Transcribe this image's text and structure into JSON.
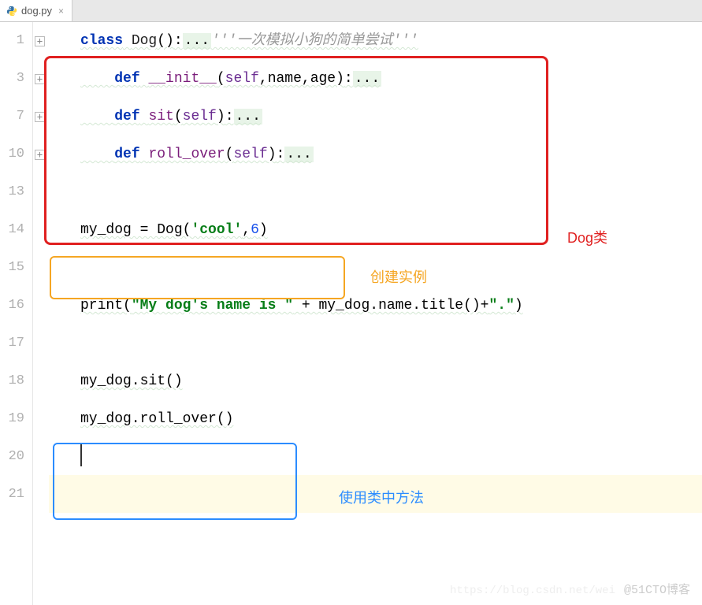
{
  "tab": {
    "filename": "dog.py",
    "close": "×"
  },
  "gutter": {
    "lines": [
      "1",
      "",
      "3",
      "",
      "7",
      "",
      "10",
      "",
      "13",
      "14",
      "",
      "15",
      "",
      "16",
      "",
      "17",
      "",
      "18",
      "19",
      "",
      "20",
      "",
      "21"
    ],
    "visible": [
      "1",
      "3",
      "7",
      "10",
      "13",
      "14",
      "15",
      "16",
      "17",
      "18",
      "19",
      "20",
      "21"
    ]
  },
  "fold_icons": "+",
  "code": {
    "l1": {
      "class": "class",
      "name": "Dog",
      "paren": "()",
      "colon_ell": ":...",
      "comment": "'''一次模拟小狗的简单尝试'''"
    },
    "l3": {
      "def": "def",
      "name": "__init__",
      "args_open": "(",
      "self": "self",
      "args_rest": ",name,age)",
      "colon_ell": ":..."
    },
    "l7": {
      "def": "def",
      "name": "sit",
      "open": "(",
      "self": "self",
      "close": ")",
      "colon_ell": ":..."
    },
    "l10": {
      "def": "def",
      "name": "roll_over",
      "open": "(",
      "self": "self",
      "close": ")",
      "colon_ell": ":..."
    },
    "l14": {
      "lhs": "my_dog = Dog(",
      "str": "'cool'",
      "mid": ",",
      "num": "6",
      "rhs": ")"
    },
    "l16": {
      "a": "print(",
      "str1": "\"My dog's name is \"",
      "b": " + my_dog.name.title()+",
      "str2": "\".\"",
      "c": ")"
    },
    "l18": "my_dog.sit()",
    "l19": "my_dog.roll_over()"
  },
  "labels": {
    "red": "Dog类",
    "orange": "创建实例",
    "blue": "使用类中方法"
  },
  "footer": {
    "watermark": "https://blog.csdn.net/wei",
    "signature": "@51CTO博客"
  }
}
